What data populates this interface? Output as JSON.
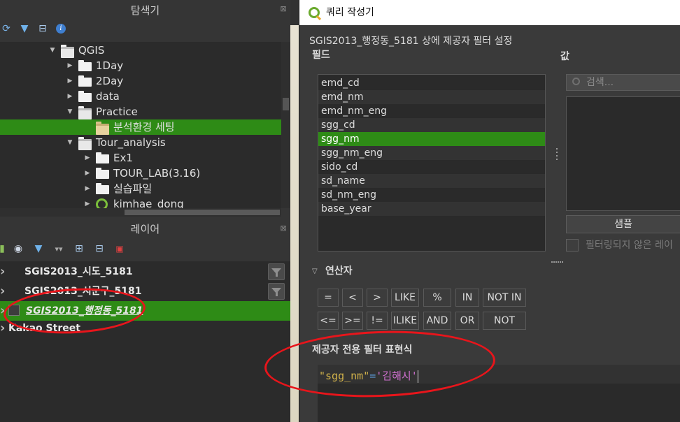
{
  "browser": {
    "title": "탐색기",
    "toolbar_icons": [
      "refresh-icon",
      "filter-icon",
      "collapse-icon",
      "info-icon"
    ],
    "tree": [
      {
        "label": "QGIS",
        "depth": 0,
        "expanded": true,
        "icon": "folder"
      },
      {
        "label": "1Day",
        "depth": 1,
        "expanded": false,
        "icon": "folder"
      },
      {
        "label": "2Day",
        "depth": 1,
        "expanded": false,
        "icon": "folder"
      },
      {
        "label": "data",
        "depth": 1,
        "expanded": false,
        "icon": "folder"
      },
      {
        "label": "Practice",
        "depth": 1,
        "expanded": true,
        "icon": "folder"
      },
      {
        "label": "분석환경 세팅",
        "depth": 2,
        "expanded": null,
        "icon": "folder-tan",
        "selected": true
      },
      {
        "label": "Tour_analysis",
        "depth": 1,
        "expanded": true,
        "icon": "folder"
      },
      {
        "label": "Ex1",
        "depth": 2,
        "expanded": false,
        "icon": "folder"
      },
      {
        "label": "TOUR_LAB(3.16)",
        "depth": 2,
        "expanded": false,
        "icon": "folder"
      },
      {
        "label": "실습파일",
        "depth": 2,
        "expanded": false,
        "icon": "folder"
      },
      {
        "label": "kimhae_dong",
        "depth": 2,
        "expanded": false,
        "icon": "qgis-project"
      }
    ]
  },
  "layers": {
    "title": "레이어",
    "items": [
      {
        "label": "SGIS2013_시도_5181",
        "selected": false,
        "filtered": true
      },
      {
        "label": "SGIS2013_시군구_5181",
        "selected": false,
        "filtered": true
      },
      {
        "label": "SGIS2013_행정동_5181",
        "selected": true,
        "filtered": false
      },
      {
        "label": "Kakao Street",
        "selected": false,
        "filtered": false
      }
    ]
  },
  "dialog": {
    "title": "쿼리 작성기",
    "subtitle": "SGIS2013_행정동_5181 상에 제공자 필터 설정",
    "fields_label": "필드",
    "values_label": "값",
    "fields": [
      "emd_cd",
      "emd_nm",
      "emd_nm_eng",
      "sgg_cd",
      "sgg_nm",
      "sgg_nm_eng",
      "sido_cd",
      "sd_name",
      "sd_nm_eng",
      "base_year"
    ],
    "selected_field": "sgg_nm",
    "search_placeholder": "검색...",
    "sample_button": "샘플",
    "unfiltered_label": "필터링되지 않은 레이",
    "operators_label": "연산자",
    "operators_row1": [
      "=",
      "<",
      ">",
      "LIKE",
      "%",
      "IN",
      "NOT IN"
    ],
    "operators_row2": [
      "<=",
      ">=",
      "!=",
      "ILIKE",
      "AND",
      "OR",
      "NOT"
    ],
    "expression_label": "제공자 전용 필터 표현식",
    "expression": {
      "ident": "\"sgg_nm\"",
      "op": "=",
      "str": "'김해시'"
    }
  },
  "colors": {
    "selection": "#2e8b16",
    "annotation": "#e8151b"
  }
}
